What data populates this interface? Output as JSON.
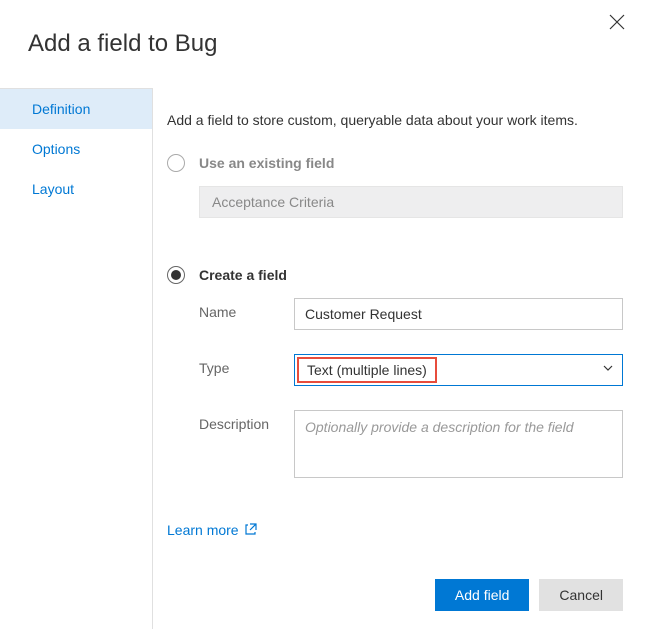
{
  "dialog": {
    "title": "Add a field to Bug",
    "close": "close"
  },
  "tabs": {
    "items": [
      {
        "label": "Definition",
        "active": true
      },
      {
        "label": "Options",
        "active": false
      },
      {
        "label": "Layout",
        "active": false
      }
    ]
  },
  "content": {
    "description": "Add a field to store custom, queryable data about your work items.",
    "existing": {
      "label": "Use an existing field",
      "value": "Acceptance Criteria"
    },
    "create": {
      "label": "Create a field",
      "name_label": "Name",
      "name_value": "Customer Request",
      "type_label": "Type",
      "type_value": "Text (multiple lines)",
      "desc_label": "Description",
      "desc_placeholder": "Optionally provide a description for the field"
    },
    "learn_more": "Learn more"
  },
  "footer": {
    "add": "Add field",
    "cancel": "Cancel"
  }
}
